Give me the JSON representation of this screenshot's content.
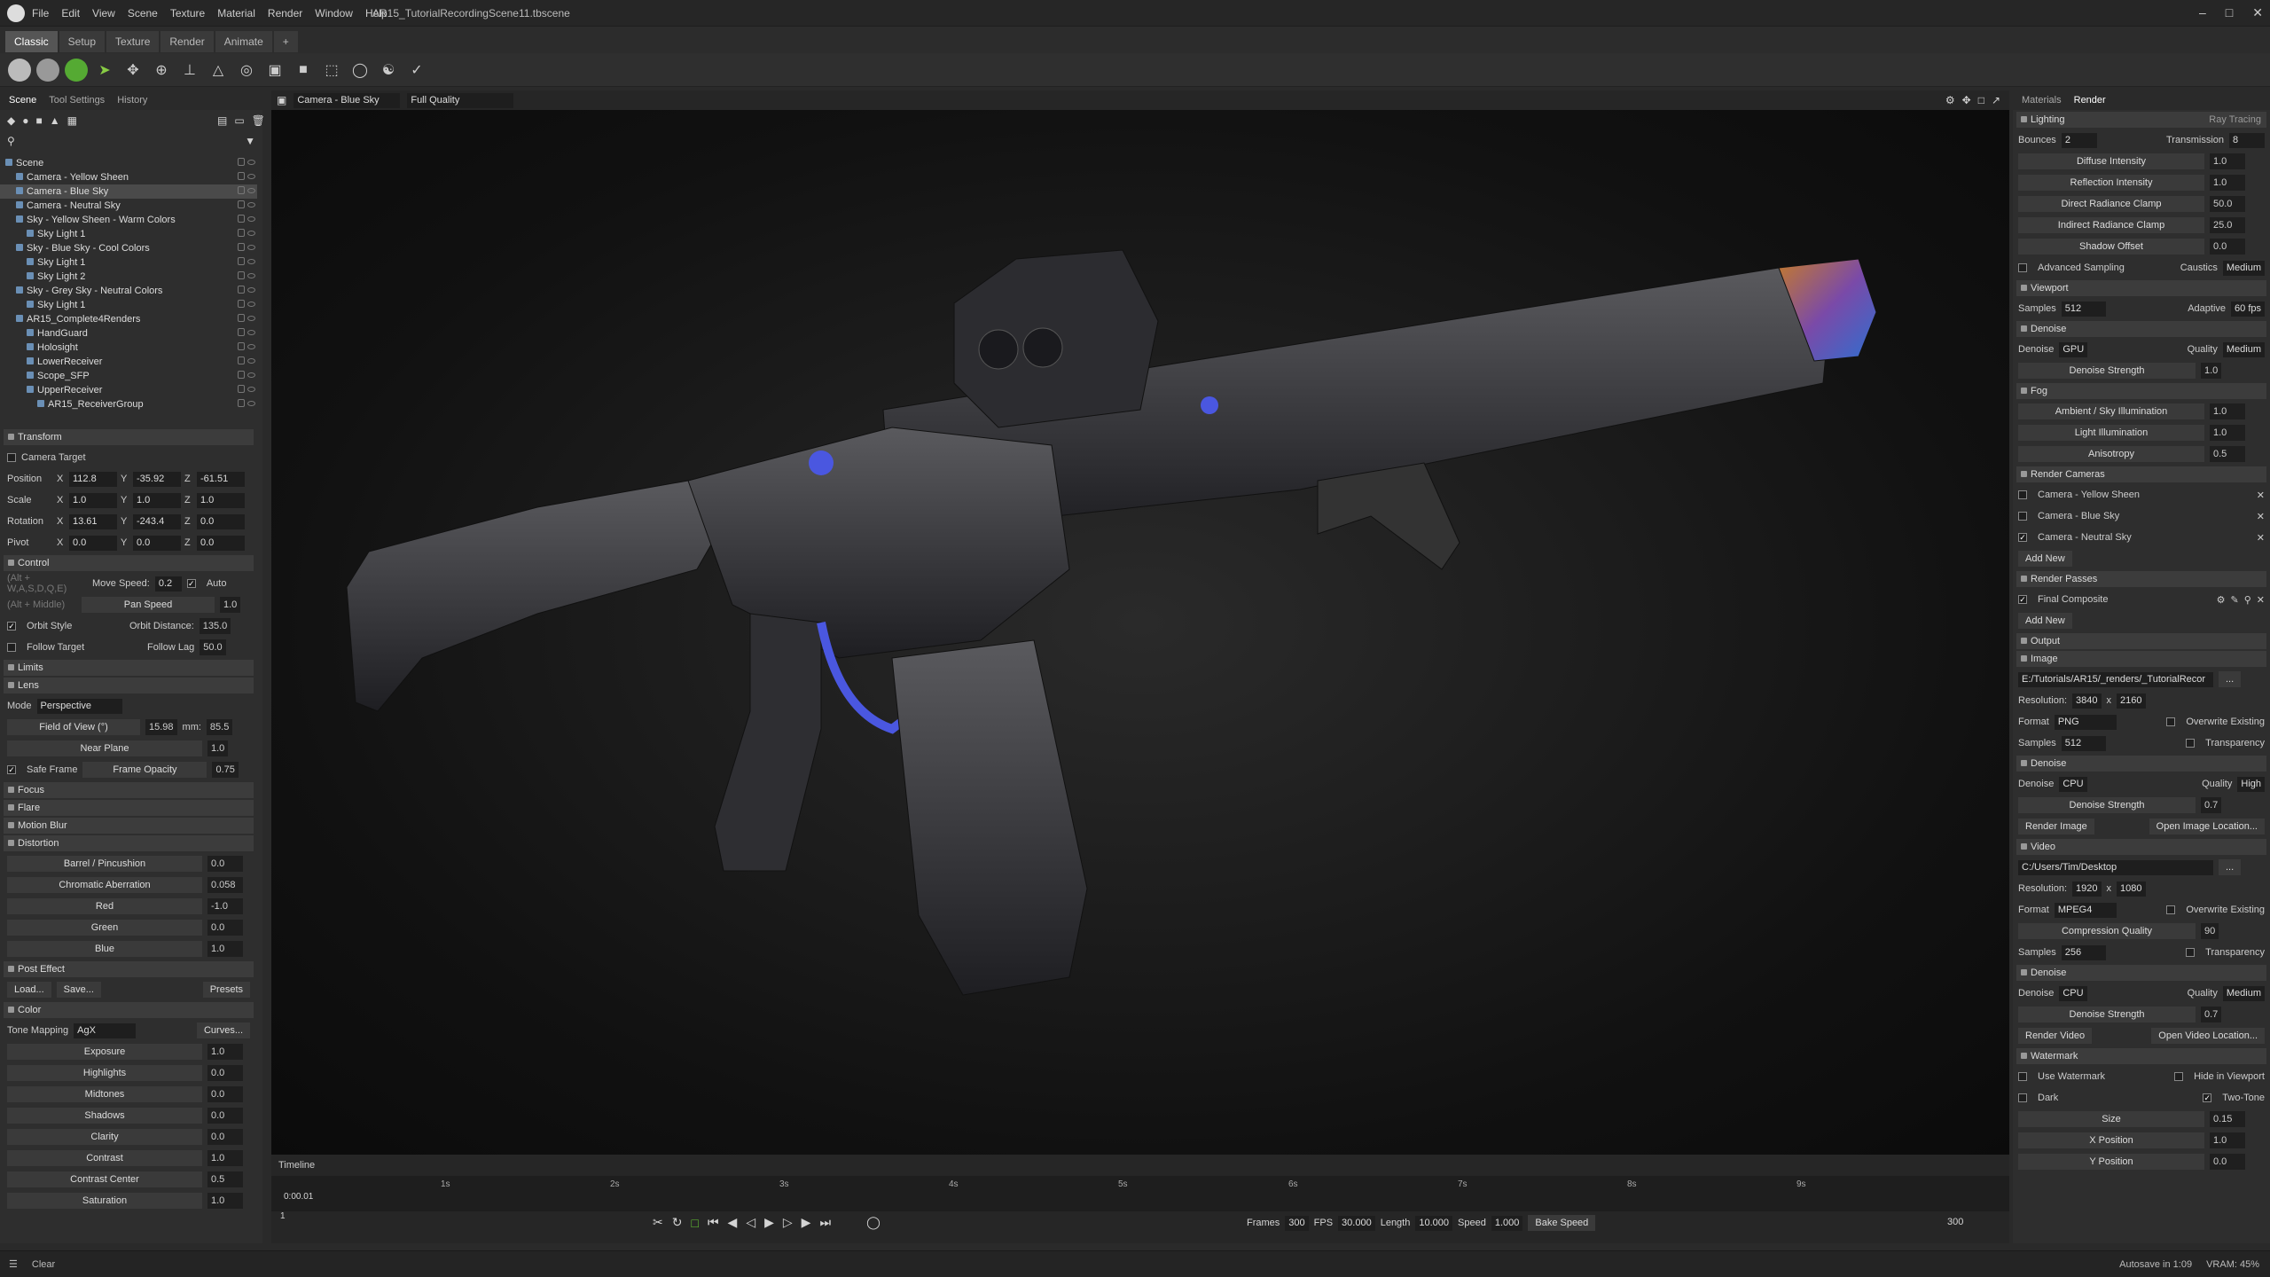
{
  "app": {
    "title": "AR15_TutorialRecordingScene11.tbscene",
    "menu": [
      "File",
      "Edit",
      "View",
      "Scene",
      "Texture",
      "Material",
      "Render",
      "Window",
      "Help"
    ],
    "mode_tabs": [
      "Classic",
      "Setup",
      "Texture",
      "Render",
      "Animate",
      "+"
    ]
  },
  "left": {
    "tabs": [
      "Scene",
      "Tool Settings",
      "History"
    ],
    "tree": [
      {
        "label": "Scene",
        "indent": 0
      },
      {
        "label": "Camera - Yellow Sheen",
        "indent": 1
      },
      {
        "label": "Camera - Blue Sky",
        "indent": 1,
        "selected": true
      },
      {
        "label": "Camera - Neutral Sky",
        "indent": 1
      },
      {
        "label": "Sky - Yellow Sheen - Warm Colors",
        "indent": 1
      },
      {
        "label": "Sky Light 1",
        "indent": 2
      },
      {
        "label": "Sky - Blue Sky - Cool Colors",
        "indent": 1
      },
      {
        "label": "Sky Light 1",
        "indent": 2
      },
      {
        "label": "Sky Light 2",
        "indent": 2
      },
      {
        "label": "Sky - Grey Sky - Neutral Colors",
        "indent": 1
      },
      {
        "label": "Sky Light 1",
        "indent": 2
      },
      {
        "label": "AR15_Complete4Renders",
        "indent": 1
      },
      {
        "label": "HandGuard",
        "indent": 2
      },
      {
        "label": "Holosight",
        "indent": 2
      },
      {
        "label": "LowerReceiver",
        "indent": 2
      },
      {
        "label": "Scope_SFP",
        "indent": 2
      },
      {
        "label": "UpperReceiver",
        "indent": 2
      },
      {
        "label": "AR15_ReceiverGroup",
        "indent": 3
      }
    ],
    "transform": {
      "title": "Transform",
      "camera_target": "Camera Target",
      "position": [
        "112.8",
        "-35.92",
        "-61.51"
      ],
      "scale": [
        "1.0",
        "1.0",
        "1.0"
      ],
      "rotation": [
        "13.61",
        "-243.4",
        "0.0"
      ],
      "pivot": [
        "0.0",
        "0.0",
        "0.0"
      ],
      "labels": [
        "Position",
        "Scale",
        "Rotation",
        "Pivot"
      ]
    },
    "control": {
      "title": "Control",
      "hint1": "(Alt + W,A,S,D,Q,E)",
      "move_speed_label": "Move Speed:",
      "move_speed": "0.2",
      "auto": "Auto",
      "hint2": "(Alt + Middle)",
      "pan_speed_label": "Pan Speed",
      "pan_speed": "1.0",
      "orbit_style": "Orbit Style",
      "orbit_distance_label": "Orbit Distance:",
      "orbit_distance": "135.0",
      "follow_target": "Follow Target",
      "follow_lag_label": "Follow Lag",
      "follow_lag": "50.0"
    },
    "limits": "Limits",
    "lens": {
      "title": "Lens",
      "mode_label": "Mode",
      "mode": "Perspective",
      "fov_label": "Field of View (°)",
      "fov": "15.98",
      "mm_label": "mm:",
      "mm": "85.5",
      "near_label": "Near Plane",
      "near": "1.0",
      "safe_frame": "Safe Frame",
      "frame_opacity_label": "Frame Opacity",
      "frame_opacity": "0.75"
    },
    "focus": "Focus",
    "flare": "Flare",
    "motion_blur": "Motion Blur",
    "distortion": {
      "title": "Distortion",
      "rows": [
        [
          "Barrel / Pincushion",
          "0.0"
        ],
        [
          "Chromatic Aberration",
          "0.058"
        ],
        [
          "Red",
          "-1.0"
        ],
        [
          "Green",
          "0.0"
        ],
        [
          "Blue",
          "1.0"
        ]
      ]
    },
    "post": {
      "title": "Post Effect",
      "load": "Load...",
      "save": "Save...",
      "presets": "Presets"
    },
    "color": {
      "title": "Color",
      "tone_label": "Tone Mapping",
      "tone": "AgX",
      "curves": "Curves...",
      "rows": [
        [
          "Exposure",
          "1.0"
        ],
        [
          "Highlights",
          "0.0"
        ],
        [
          "Midtones",
          "0.0"
        ],
        [
          "Shadows",
          "0.0"
        ],
        [
          "Clarity",
          "0.0"
        ],
        [
          "Contrast",
          "1.0"
        ],
        [
          "Contrast Center",
          "0.5"
        ],
        [
          "Saturation",
          "1.0"
        ]
      ]
    }
  },
  "viewport": {
    "camera": "Camera - Blue Sky",
    "quality": "Full Quality"
  },
  "timeline": {
    "title": "Timeline",
    "time": "0:00.01",
    "frame": "1",
    "ticks": [
      "1s",
      "2s",
      "3s",
      "4s",
      "5s",
      "6s",
      "7s",
      "8s",
      "9s"
    ],
    "frames_label": "Frames",
    "frames": "300",
    "fps_label": "FPS",
    "fps": "30.000",
    "length_label": "Length",
    "length": "10.000",
    "speed_label": "Speed",
    "speed": "1.000",
    "bake": "Bake Speed",
    "end": "300"
  },
  "right": {
    "tabs": [
      "Materials",
      "Render"
    ],
    "lighting": {
      "title": "Lighting",
      "mode": "Ray Tracing",
      "bounces_label": "Bounces",
      "bounces": "2",
      "transmission_label": "Transmission",
      "transmission": "8",
      "rows": [
        [
          "Diffuse Intensity",
          "1.0"
        ],
        [
          "Reflection Intensity",
          "1.0"
        ],
        [
          "Direct Radiance Clamp",
          "50.0"
        ],
        [
          "Indirect Radiance Clamp",
          "25.0"
        ],
        [
          "Shadow Offset",
          "0.0"
        ]
      ],
      "adv": "Advanced Sampling",
      "caustics_label": "Caustics",
      "caustics": "Medium"
    },
    "viewport": {
      "title": "Viewport",
      "samples_label": "Samples",
      "samples": "512",
      "adaptive_label": "Adaptive",
      "adaptive": "60 fps",
      "denoise_title": "Denoise",
      "denoise_label": "Denoise",
      "denoise": "GPU",
      "quality_label": "Quality",
      "quality": "Medium",
      "strength_label": "Denoise Strength",
      "strength": "1.0"
    },
    "fog": {
      "title": "Fog",
      "rows": [
        [
          "Ambient / Sky Illumination",
          "1.0"
        ],
        [
          "Light Illumination",
          "1.0"
        ],
        [
          "Anisotropy",
          "0.5"
        ]
      ]
    },
    "cameras": {
      "title": "Render Cameras",
      "items": [
        "Camera - Yellow Sheen",
        "Camera - Blue Sky",
        "Camera - Neutral Sky"
      ],
      "add": "Add New"
    },
    "passes": {
      "title": "Render Passes",
      "item": "Final Composite",
      "add": "Add New"
    },
    "output": {
      "title": "Output",
      "image_title": "Image",
      "image_path": "E:/Tutorials/AR15/_renders/_TutorialRecor",
      "res_label": "Resolution:",
      "res_w": "3840",
      "res_h": "2160",
      "format_label": "Format",
      "format": "PNG",
      "overwrite": "Overwrite Existing",
      "samples_label": "Samples",
      "samples": "512",
      "transparency": "Transparency",
      "denoise_title": "Denoise",
      "denoise_label": "Denoise",
      "denoise": "CPU",
      "quality_label": "Quality",
      "quality": "High",
      "strength_label": "Denoise Strength",
      "strength": "0.7",
      "render_image": "Render Image",
      "open_image": "Open Image Location..."
    },
    "video": {
      "title": "Video",
      "path": "C:/Users/Tim/Desktop",
      "res_w": "1920",
      "res_h": "1080",
      "format": "MPEG4",
      "overwrite": "Overwrite Existing",
      "compression_label": "Compression Quality",
      "compression": "90",
      "samples": "256",
      "transparency": "Transparency",
      "denoise_title": "Denoise",
      "denoise": "CPU",
      "quality": "Medium",
      "strength": "0.7",
      "render_video": "Render Video",
      "open_video": "Open Video Location..."
    },
    "watermark": {
      "title": "Watermark",
      "use": "Use Watermark",
      "hide": "Hide in Viewport",
      "dark": "Dark",
      "two_tone": "Two-Tone",
      "rows": [
        [
          "Size",
          "0.15"
        ],
        [
          "X Position",
          "1.0"
        ],
        [
          "Y Position",
          "0.0"
        ]
      ]
    }
  },
  "status": {
    "clear": "Clear",
    "autosave": "Autosave in 1:09",
    "vram": "VRAM: 45%"
  }
}
